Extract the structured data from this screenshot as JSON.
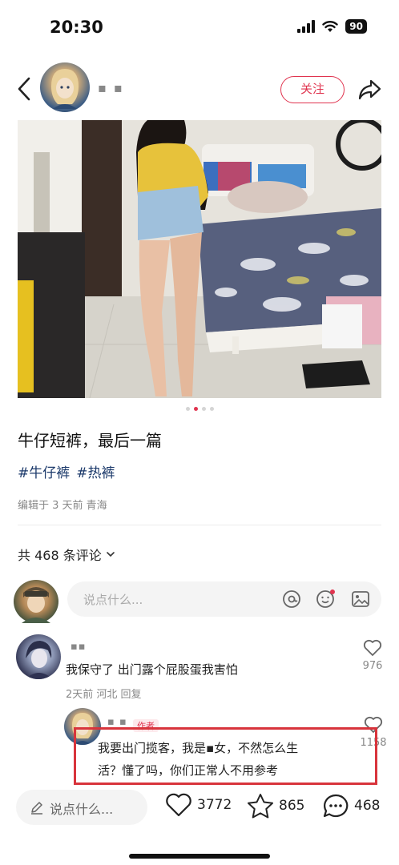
{
  "status_bar": {
    "time": "20:30",
    "battery": "90"
  },
  "header": {
    "author_name": "▪ ▪",
    "follow_label": "关注"
  },
  "gallery": {
    "total": 4,
    "active_index": 1
  },
  "post": {
    "title": "牛仔短裤，最后一篇",
    "tags": [
      "#牛仔裤",
      "#热裤"
    ],
    "meta": "编辑于 3 天前 青海"
  },
  "comments_header": {
    "count_label": "共 468 条评论"
  },
  "comment_input": {
    "placeholder": "说点什么..."
  },
  "comments": [
    {
      "name": "▪▪",
      "text": "我保守了 出门露个屁股蛋我害怕",
      "meta": "2天前 河北 回复",
      "likes": "976"
    },
    {
      "name": "▪ ▪",
      "badge": "作者",
      "text_line1": "我要出门揽客，我是▪女，不然怎么生",
      "text_line2": "活？懂了吗，你们正常人不用参考",
      "likes": "1158"
    }
  ],
  "bottom_bar": {
    "placeholder": "说点什么...",
    "likes": "3772",
    "stars": "865",
    "comments": "468"
  },
  "colors": {
    "accent": "#e0344f",
    "tag": "#1c3a6b",
    "highlight_box": "#d8343c"
  },
  "icons": [
    "back-icon",
    "share-icon",
    "chevron-down-icon",
    "at-icon",
    "emoji-icon",
    "image-icon",
    "heart-icon",
    "star-icon",
    "comment-icon",
    "pen-icon"
  ]
}
